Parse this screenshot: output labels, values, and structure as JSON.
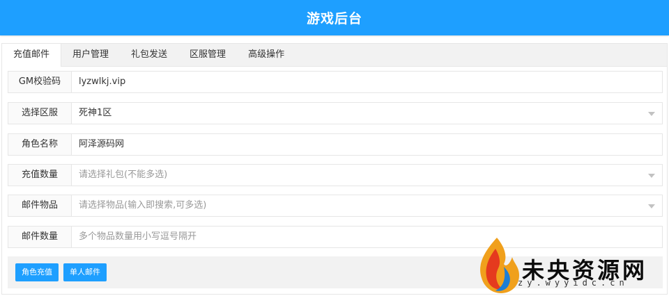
{
  "header": {
    "title": "游戏后台"
  },
  "tabs": [
    {
      "label": "充值邮件"
    },
    {
      "label": "用户管理"
    },
    {
      "label": "礼包发送"
    },
    {
      "label": "区服管理"
    },
    {
      "label": "高级操作"
    }
  ],
  "form": {
    "gm_code": {
      "label": "GM校验码",
      "value": "lyzwlkj.vip"
    },
    "server": {
      "label": "选择区服",
      "value": "死神1区"
    },
    "role_name": {
      "label": "角色名称",
      "value": "阿泽源码网"
    },
    "recharge_amount": {
      "label": "充值数量",
      "placeholder": "请选择礼包(不能多选)"
    },
    "mail_items": {
      "label": "邮件物品",
      "placeholder": "请选择物品(输入即搜索,可多选)"
    },
    "mail_quantity": {
      "label": "邮件数量",
      "placeholder": "多个物品数量用小写逗号隔开"
    }
  },
  "buttons": {
    "role_recharge": "角色充值",
    "single_mail": "单人邮件"
  },
  "watermark": {
    "name": "未央资源网",
    "url": "zy.wyyidc.cn"
  },
  "colors": {
    "accent": "#1e9fff",
    "tab_bar": "#f2f2f2",
    "border": "#e6e6e6"
  }
}
